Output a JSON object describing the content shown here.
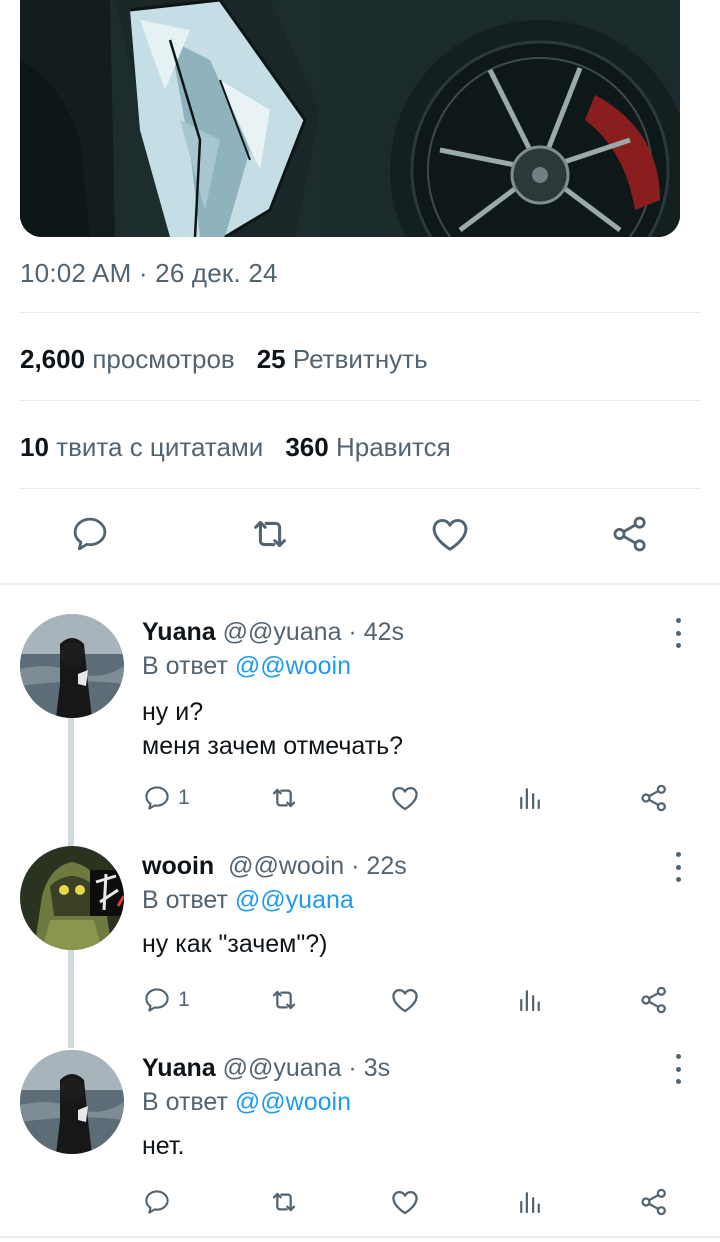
{
  "tweet": {
    "timestamp": "10:02 AM · 26 дек. 24",
    "views_count": "2,600",
    "views_label": "просмотров",
    "retweets_count": "25",
    "retweets_label": "Ретвитнуть",
    "quotes_count": "10",
    "quotes_label": "твита с цитатами",
    "likes_count": "360",
    "likes_label": "Нравится"
  },
  "icons": {
    "reply": "reply-icon",
    "retweet": "retweet-icon",
    "like": "heart-icon",
    "share": "share-icon",
    "views": "views-chart-icon",
    "more": "more-vertical-icon"
  },
  "colors": {
    "text": "#0f1419",
    "secondary": "#536471",
    "link": "#1d9bf0",
    "divider": "#e6ecf0",
    "thread_line": "#cfd9de"
  },
  "replies": [
    {
      "name": "Yuana",
      "meta": "@@yuana · 42s",
      "reply_to_prefix": "В ответ",
      "reply_to_handle": "@@wooin",
      "text": "ну и?\nменя зачем отмечать?",
      "reply_count": "1"
    },
    {
      "name": "wooin",
      "meta": "@@wooin · 22s",
      "reply_to_prefix": "В ответ",
      "reply_to_handle": "@@yuana",
      "text": "ну как \"зачем\"?)",
      "reply_count": "1"
    },
    {
      "name": "Yuana",
      "meta": "@@yuana · 3s",
      "reply_to_prefix": "В ответ",
      "reply_to_handle": "@@wooin",
      "text": "нет.",
      "reply_count": ""
    }
  ]
}
